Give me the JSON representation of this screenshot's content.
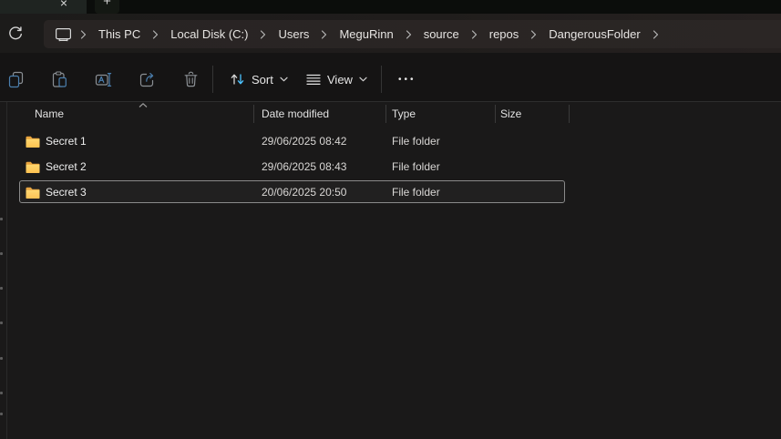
{
  "colors": {
    "accent_blue": "#4cc2ff",
    "icon_blue": "#4b7fae",
    "icon_gray": "#8b9095",
    "folder_top": "#e8a33d",
    "folder_front_light": "#ffd76e",
    "folder_front_dark": "#fdc150",
    "selection_outline": "#8a8a8a"
  },
  "tab_bar": {
    "close_glyph": "×",
    "new_tab_glyph": "+"
  },
  "address_bar": {
    "breadcrumbs": [
      {
        "label": "This PC"
      },
      {
        "label": "Local Disk (C:)"
      },
      {
        "label": "Users"
      },
      {
        "label": "MeguRinn"
      },
      {
        "label": "source"
      },
      {
        "label": "repos"
      },
      {
        "label": "DangerousFolder"
      }
    ]
  },
  "toolbar": {
    "sort_label": "Sort",
    "view_label": "View",
    "more_glyph": "•••"
  },
  "file_list": {
    "columns": [
      {
        "label": "Name",
        "sort": "asc"
      },
      {
        "label": "Date modified",
        "sort": ""
      },
      {
        "label": "Type",
        "sort": ""
      },
      {
        "label": "Size",
        "sort": ""
      }
    ],
    "rows": [
      {
        "name": "Secret 1",
        "date_modified": "29/06/2025 08:42",
        "type": "File folder",
        "size": "",
        "selected": false
      },
      {
        "name": "Secret 2",
        "date_modified": "29/06/2025 08:43",
        "type": "File folder",
        "size": "",
        "selected": false
      },
      {
        "name": "Secret 3",
        "date_modified": "20/06/2025 20:50",
        "type": "File folder",
        "size": "",
        "selected": true
      }
    ]
  },
  "icons": {
    "refresh": "circular-arrow",
    "this_pc": "monitor",
    "breadcrumb_chevron": "›",
    "copy": "overlapping-rectangles",
    "paste": "clipboard",
    "rename": "boxed-A-with-ibeam",
    "share": "arrow-out-of-box",
    "delete": "trash-can",
    "sort": "up-down-arrows",
    "view": "stacked-lines",
    "sort_ascending": "^",
    "folder": "yellow-folder"
  }
}
